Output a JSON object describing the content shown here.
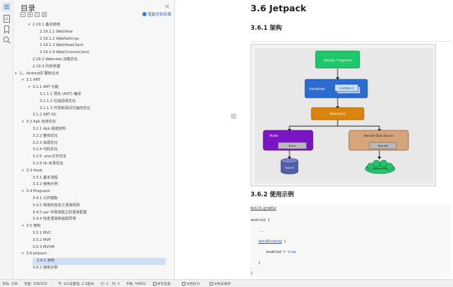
{
  "toc": {
    "title": "目录",
    "close": "×",
    "smart_toc": "智能识别目录",
    "items": [
      {
        "text": "2.19.1 基本使用",
        "level": 3,
        "caret": "▾"
      },
      {
        "text": "2.19.1.1 WebView",
        "level": 4,
        "caret": ""
      },
      {
        "text": "2.19.1.2 WebSettings",
        "level": 4,
        "caret": ""
      },
      {
        "text": "2.19.1.3 WebViewClient",
        "level": 4,
        "caret": ""
      },
      {
        "text": "2.19.1.4 WebChromeClient",
        "level": 4,
        "caret": ""
      },
      {
        "text": "2.19.2 Webview 加载优化",
        "level": 3,
        "caret": ""
      },
      {
        "text": "2.19.3 内存泄漏",
        "level": 3,
        "caret": ""
      },
      {
        "text": "三、Android扩展知识点",
        "level": 1,
        "caret": "▾"
      },
      {
        "text": "3.1 ART",
        "level": 2,
        "caret": "▾"
      },
      {
        "text": "3.1.1 ART 功能",
        "level": 3,
        "caret": "▾"
      },
      {
        "text": "3.1.1.1 预先 (AOT) 编译",
        "level": 4,
        "caret": ""
      },
      {
        "text": "3.1.1.2 垃圾回收优化",
        "level": 4,
        "caret": ""
      },
      {
        "text": "3.1.1.3 开发和调试方面的优化",
        "level": 4,
        "caret": ""
      },
      {
        "text": "3.1.2 ART GC",
        "level": 3,
        "caret": ""
      },
      {
        "text": "3.2 Apk 包体优化",
        "level": 2,
        "caret": "▾"
      },
      {
        "text": "3.2.1 Apk 组成结构",
        "level": 3,
        "caret": ""
      },
      {
        "text": "3.2.2 整体优化",
        "level": 3,
        "caret": ""
      },
      {
        "text": "3.2.3 资源优化",
        "level": 3,
        "caret": ""
      },
      {
        "text": "3.2.4 代码优化",
        "level": 3,
        "caret": ""
      },
      {
        "text": "3.2.5 .arsc文件优化",
        "level": 3,
        "caret": ""
      },
      {
        "text": "3.2.6 lib 目录优化",
        "level": 3,
        "caret": ""
      },
      {
        "text": "3.3 Hook",
        "level": 2,
        "caret": "▾"
      },
      {
        "text": "3.3.1 基本流程",
        "level": 3,
        "caret": ""
      },
      {
        "text": "3.3.2 使用示例",
        "level": 3,
        "caret": ""
      },
      {
        "text": "3.4 Proguard",
        "level": 2,
        "caret": "▾"
      },
      {
        "text": "3.4.1 公共模板",
        "level": 3,
        "caret": ""
      },
      {
        "text": "3.4.2 常用的自定义混淆规则",
        "level": 3,
        "caret": ""
      },
      {
        "text": "3.4.3 aar 中增加独立的混淆配置",
        "level": 3,
        "caret": ""
      },
      {
        "text": "3.4.4 检查混淆和追踪异常",
        "level": 3,
        "caret": ""
      },
      {
        "text": "3.5 架构",
        "level": 2,
        "caret": "▾"
      },
      {
        "text": "3.5.1 MVC",
        "level": 3,
        "caret": ""
      },
      {
        "text": "3.5.2 MVP",
        "level": 3,
        "caret": ""
      },
      {
        "text": "3.5.3 MVVM",
        "level": 3,
        "caret": ""
      },
      {
        "text": "3.6 Jetpack",
        "level": 2,
        "caret": "▾"
      },
      {
        "text": "3.6.1 架构",
        "level": 3,
        "caret": "",
        "selected": true
      },
      {
        "text": "3.6.2 使用示例",
        "level": 3,
        "caret": ""
      }
    ]
  },
  "doc": {
    "h1": "3.6 Jetpack",
    "h2_arch": "3.6.1 架构",
    "h2_example": "3.6.2 使用示例",
    "diagram": {
      "activity": "Activity / Fragment",
      "viewmodel": "ViewModel",
      "livedata": "LiveData",
      "livedata_count": "3",
      "repository": "Repository",
      "model": "Model",
      "room": "Room",
      "remote": "Remote Data Source",
      "retrofit": "Retrofit",
      "sqlite": "SQLite",
      "webservice": "webservice"
    },
    "code": {
      "file": "build.gradle",
      "line1": "android {",
      "line2": "...",
      "line3_key": "dataBinding",
      "line3_rest": " {",
      "line4_key": "enabled = ",
      "line4_val": "true",
      "line5": "}",
      "line6": "}"
    }
  },
  "status": {
    "page_index": "页码: 106",
    "page_count": "页面: 106/330",
    "section": "节: 2/2",
    "setting": "设置值: 2.5厘米",
    "row": "行: 1",
    "col": "列: 3",
    "words": "字数: 54602",
    "spell": "拼写检查",
    "proof": "文档校对",
    "protect": "文档未保护"
  }
}
